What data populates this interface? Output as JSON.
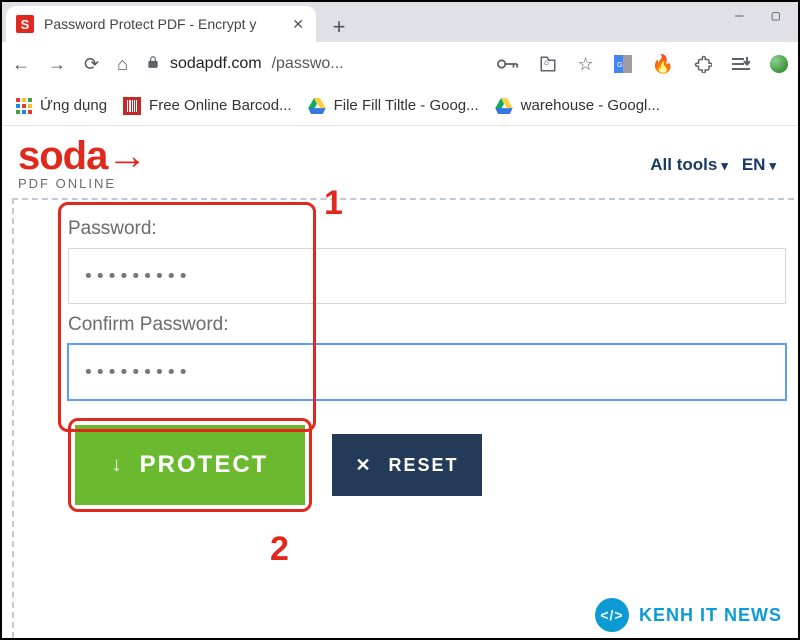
{
  "browser": {
    "tab": {
      "favicon_letter": "S",
      "title": "Password Protect PDF - Encrypt y"
    },
    "url": {
      "host": "sodapdf.com",
      "path": "/passwo..."
    },
    "bookmarks": {
      "apps": "Ứng dụng",
      "barcode": "Free Online Barcod...",
      "filefill": "File Fill Tiltle - Goog...",
      "warehouse": "warehouse - Googl..."
    }
  },
  "brand": {
    "logo_word": "soda",
    "logo_arrow": "→",
    "logo_sub": "PDF ONLINE"
  },
  "nav": {
    "all_tools": "All tools",
    "lang": "EN"
  },
  "form": {
    "password_label": "Password:",
    "confirm_label": "Confirm Password:",
    "password_value": "•••••••••",
    "confirm_value": "•••••••••",
    "protect_button": "PROTECT",
    "reset_button": "RESET"
  },
  "annotations": {
    "one": "1",
    "two": "2"
  },
  "watermark": {
    "badge": "</>",
    "text": "KENH IT NEWS"
  }
}
